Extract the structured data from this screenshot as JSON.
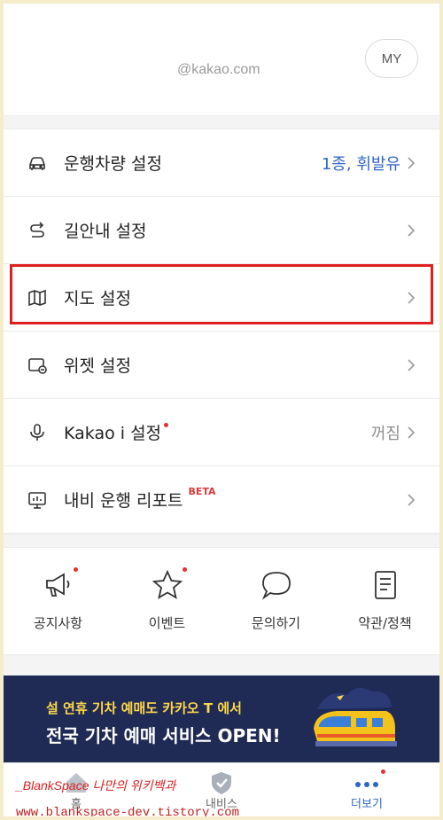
{
  "profile": {
    "email": "@kakao.com",
    "my_button": "MY"
  },
  "settings": [
    {
      "icon": "car-icon",
      "label": "운행차량 설정",
      "value": "1종, 휘발유",
      "value_color": "#2f66c5"
    },
    {
      "icon": "route-icon",
      "label": "길안내 설정",
      "value": ""
    },
    {
      "icon": "map-icon",
      "label": "지도 설정",
      "value": "",
      "highlighted": true
    },
    {
      "icon": "widget-icon",
      "label": "위젯 설정",
      "value": ""
    },
    {
      "icon": "microphone-icon",
      "label": "Kakao i 설정",
      "value": "꺼짐",
      "badge_dot": true
    },
    {
      "icon": "report-icon",
      "label": "내비 운행 리포트",
      "value": "",
      "badge": "BETA"
    }
  ],
  "shortcuts": [
    {
      "icon": "megaphone-icon",
      "label": "공지사항",
      "dot": true
    },
    {
      "icon": "star-icon",
      "label": "이벤트",
      "dot": true
    },
    {
      "icon": "chat-bubble-icon",
      "label": "문의하기",
      "dot": false
    },
    {
      "icon": "document-icon",
      "label": "약관/정책",
      "dot": false
    }
  ],
  "banner": {
    "line1": "설 연휴 기차 예매도 카카오 T 에서",
    "line2": "전국 기차 예매 서비스 OPEN!",
    "colors": {
      "background": "#1f2a55",
      "headline": "#ffffff",
      "subline": "#ffd84a"
    }
  },
  "tabs": [
    {
      "icon": "home-icon",
      "label": "홈",
      "active": false
    },
    {
      "icon": "shield-check-icon",
      "label": "내비스",
      "active": false
    },
    {
      "icon": "more-dots-icon",
      "label": "더보기",
      "active": true
    }
  ],
  "watermark": {
    "line1": "_BlankSpace 나만의 위키백과",
    "line2": "www.blankspace-dev.tistory.com"
  },
  "colors": {
    "accent": "#2f66c5",
    "highlight_border": "#dd1f1f",
    "badge_red": "#e1322f"
  }
}
